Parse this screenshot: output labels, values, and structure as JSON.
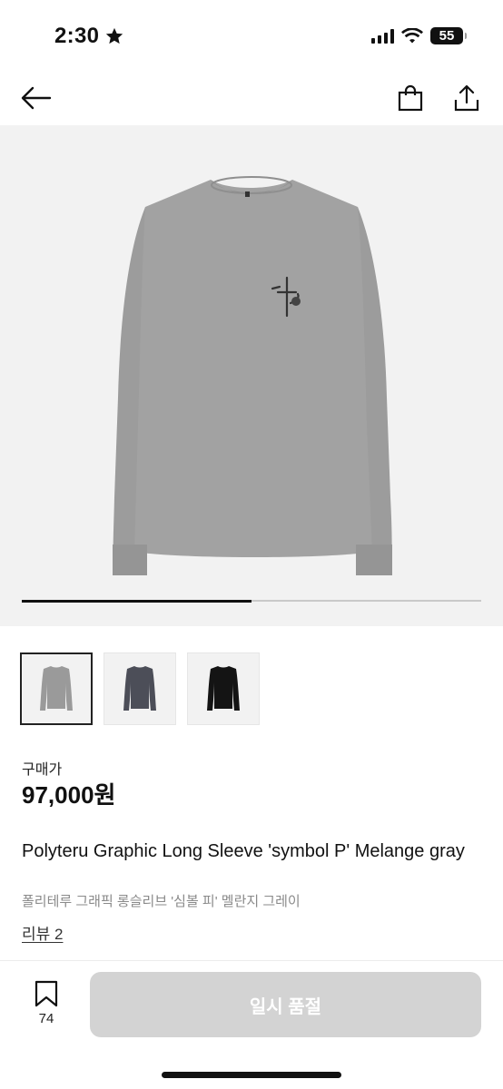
{
  "status_bar": {
    "time": "2:30",
    "battery": "55"
  },
  "nav": {
    "back_icon": "arrow-left-icon",
    "bag_icon": "shopping-bag-icon",
    "share_icon": "share-icon"
  },
  "product_image": {
    "description_icon": "long-sleeve-tee-melange-gray",
    "carousel_progress": 0.5
  },
  "thumbnails": [
    {
      "color": "#9a9a9a",
      "selected": true
    },
    {
      "color": "#4c4e58",
      "selected": false
    },
    {
      "color": "#141414",
      "selected": false
    }
  ],
  "price": {
    "label": "구매가",
    "value": "97,000원"
  },
  "product": {
    "title_en": "Polyteru Graphic Long Sleeve 'symbol P' Melange gray",
    "title_ko": "폴리테루 그래픽 롱슬리브 '심볼 피' 멜란지 그레이",
    "review_link": "리뷰 2"
  },
  "bottom_bar": {
    "bookmark_count": "74",
    "buy_button_label": "일시 품절",
    "buy_button_color": "#d3d3d3"
  }
}
